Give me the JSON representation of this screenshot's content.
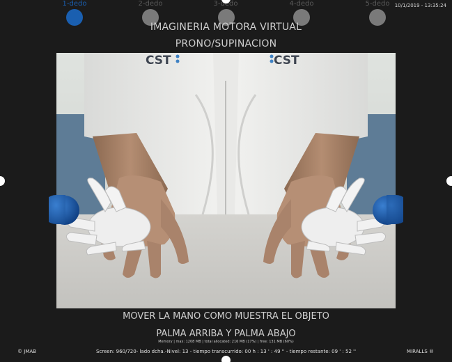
{
  "fingers": [
    {
      "label": "1-dedo",
      "active": true
    },
    {
      "label": "2-dedo",
      "active": false
    },
    {
      "label": "3-dedo",
      "active": false
    },
    {
      "label": "4-dedo",
      "active": false
    },
    {
      "label": "5-dedo",
      "active": false
    }
  ],
  "datetime": "10/1/2019 - 13:35:24",
  "header": {
    "title": "IMAGINERIA MOTORA VIRTUAL",
    "subtitle": "PRONO/SUPINACION"
  },
  "camera": {
    "shirt_logo_left": "CST",
    "shirt_logo_right": "CST"
  },
  "instructions": {
    "line1": "MOVER LA MANO COMO MUESTRA EL OBJETO",
    "line2": "PALMA ARRIBA Y PALMA ABAJO"
  },
  "memory": "Memory  |  max: 1208 MB  |  total allocated: 216 MB  (17%)  |  free: 131 MB  (60%)",
  "footer": {
    "left": "© JMAB",
    "center": "Screen: 960/720- lado dcha.-Nivel: 13 - tiempo transcurrido: 00 h : 13 ' : 49 '' - tiempo restante: 09 ' : 52 ''",
    "right": "MIRALLS ®"
  },
  "colors": {
    "background": "#1b1b1b",
    "active_dot": "#1a5fb0",
    "inactive_dot": "#7a7a7a",
    "target_ball": "#1556a6"
  }
}
